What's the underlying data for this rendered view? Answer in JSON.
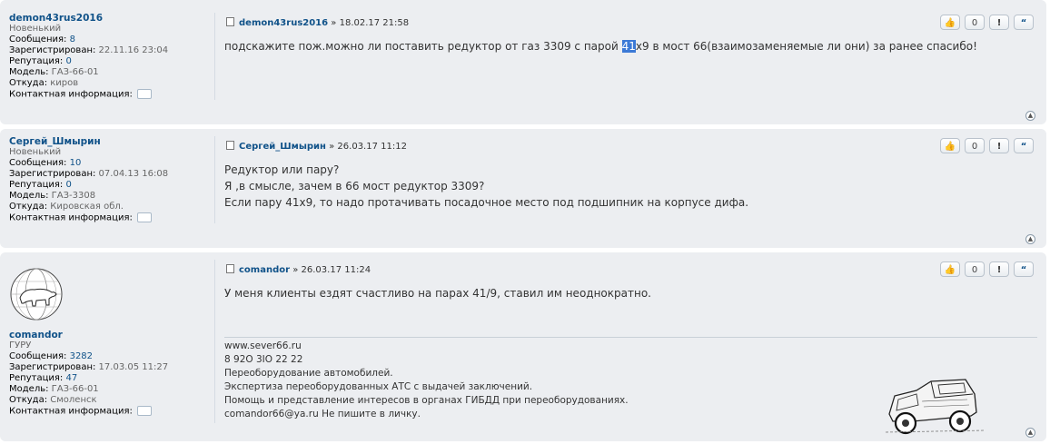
{
  "posts": [
    {
      "username": "demon43rus2016",
      "rank": "Новенький",
      "profile": [
        {
          "label": "Сообщения:",
          "value": "8"
        },
        {
          "label": "Зарегистрирован:",
          "value": "22.11.16 23:04"
        },
        {
          "label": "Репутация:",
          "value": "0"
        },
        {
          "label": "Модель:",
          "value": "ГАЗ-66-01"
        },
        {
          "label": "Откуда:",
          "value": "киров"
        }
      ],
      "contact_label": "Контактная информация:",
      "meta": "» 18.02.17 21:58",
      "content_before": "подскажите пож.можно ли поставить редуктор от газ 3309 с парой ",
      "content_highlight": "41",
      "content_after": "х9 в мост 66(взаимозаменяемые ли они) за ранее спасибо!"
    },
    {
      "username": "Сергей_Шмырин",
      "rank": "Новенький",
      "profile": [
        {
          "label": "Сообщения:",
          "value": "10"
        },
        {
          "label": "Зарегистрирован:",
          "value": "07.04.13 16:08"
        },
        {
          "label": "Репутация:",
          "value": "0"
        },
        {
          "label": "Модель:",
          "value": "ГАЗ-3308"
        },
        {
          "label": "Откуда:",
          "value": "Кировская обл."
        }
      ],
      "contact_label": "Контактная информация:",
      "meta": "» 26.03.17 11:12",
      "lines": [
        "Редуктор или пару?",
        "Я ,в смысле, зачем в 66 мост редуктор 3309?",
        "Если пару 41х9, то надо протачивать посадочное место под подшипник на корпусе дифа."
      ]
    },
    {
      "username": "comandor",
      "rank": "ГУРУ",
      "profile": [
        {
          "label": "Сообщения:",
          "value": "3282"
        },
        {
          "label": "Зарегистрирован:",
          "value": "17.03.05 11:27"
        },
        {
          "label": "Репутация:",
          "value": "47"
        },
        {
          "label": "Модель:",
          "value": "ГАЗ-66-01"
        },
        {
          "label": "Откуда:",
          "value": "Смоленск"
        }
      ],
      "contact_label": "Контактная информация:",
      "meta": "» 26.03.17 11:24",
      "lines": [
        "У меня клиенты ездят счастливо на парах 41/9, ставил им неоднократно."
      ],
      "signature": [
        "www.sever66.ru",
        "8 92О 3IО 22 22",
        "Переоборудование автомобилей.",
        "Экспертиза переоборудованных АТС с выдачей заключений.",
        "Помощь и представление интересов в органах ГИБДД при переоборудованиях.",
        "comandor66@ya.ru Не пишите в личку."
      ]
    }
  ],
  "buttons": {
    "like": "👍",
    "count": "0",
    "report": "!",
    "quote": "“"
  },
  "icons": {
    "top": "▲"
  }
}
